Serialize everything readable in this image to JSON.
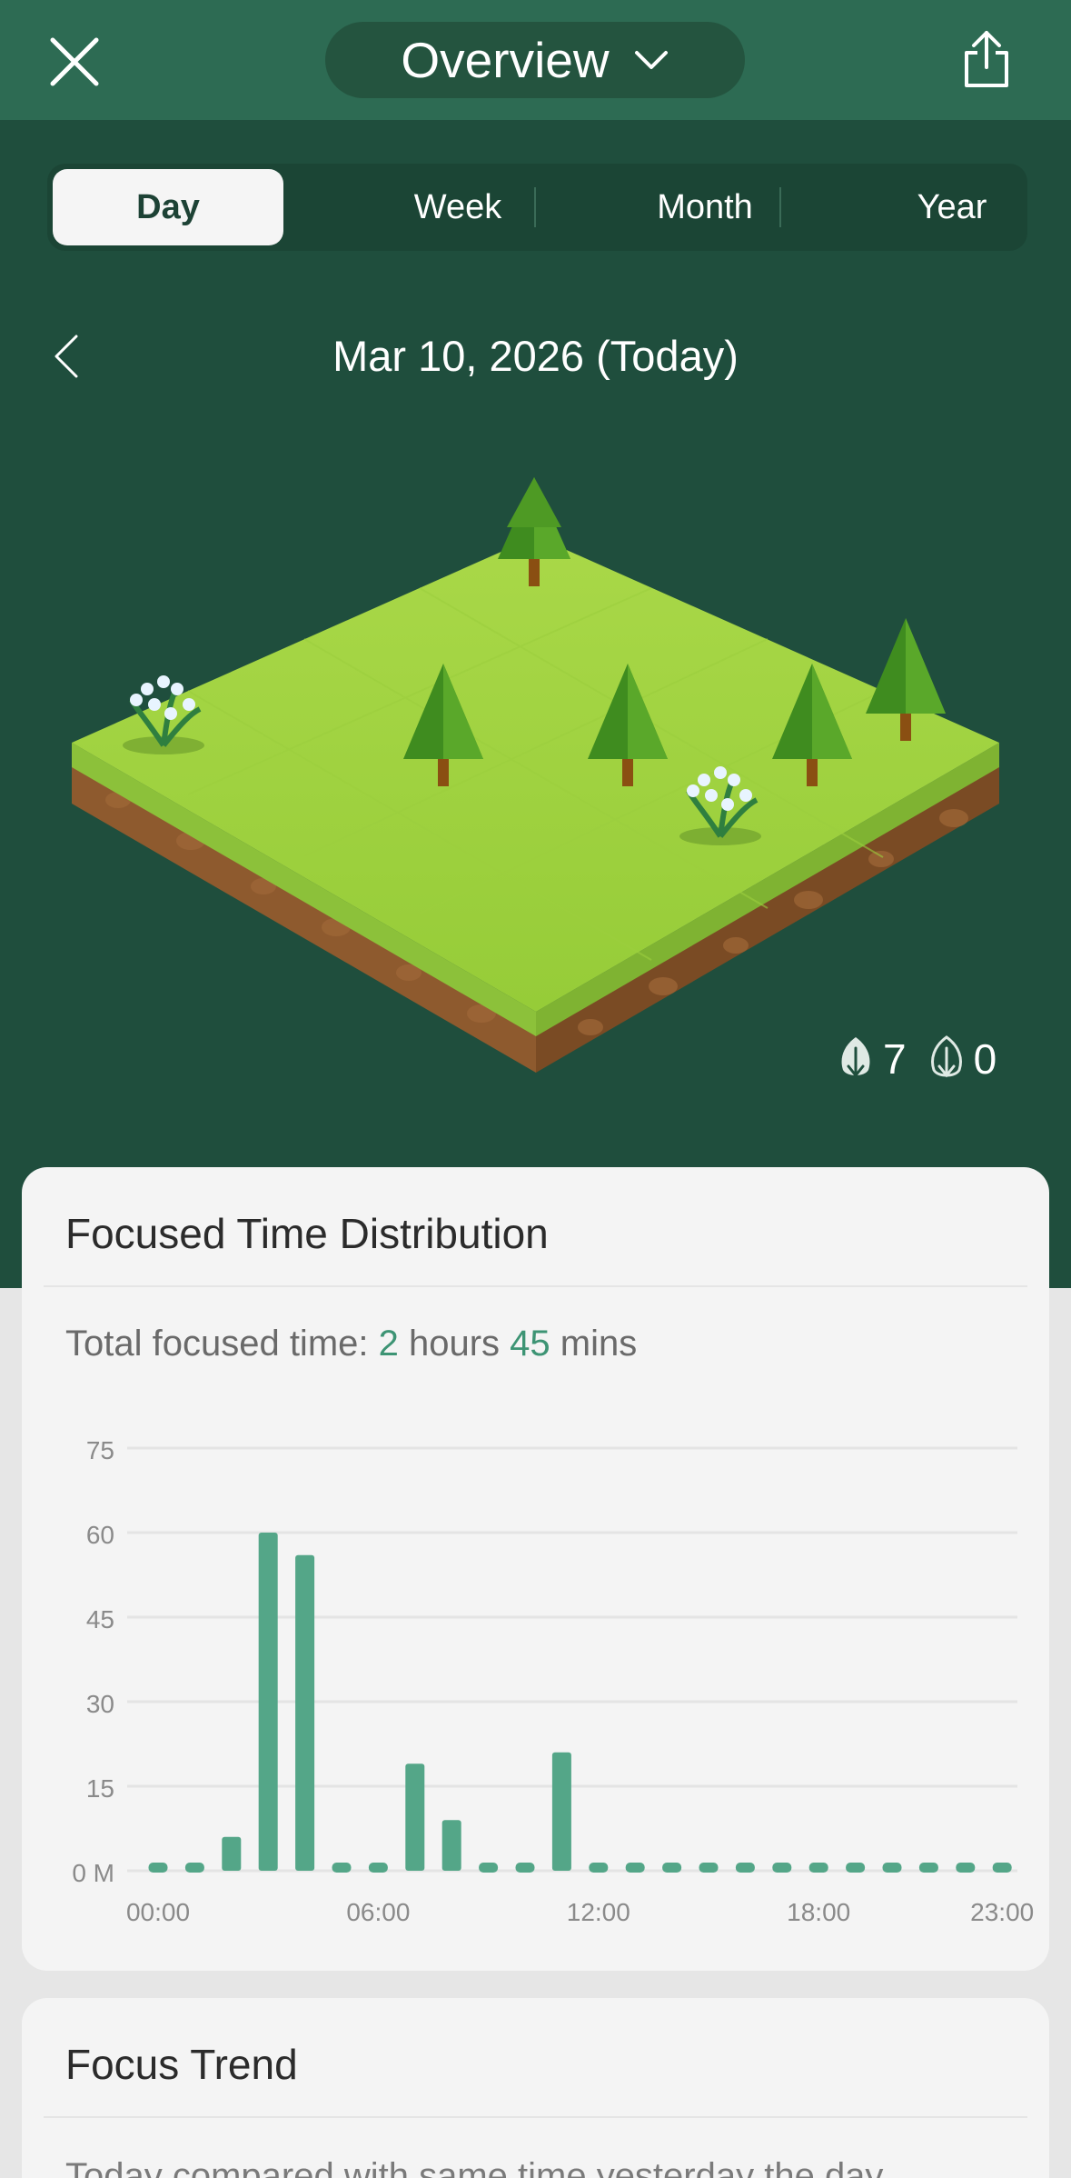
{
  "header": {
    "title": "Overview",
    "close_icon": "close-icon",
    "share_icon": "share-icon",
    "dropdown_icon": "chevron-down-icon"
  },
  "period_tabs": [
    {
      "label": "Day",
      "selected": true
    },
    {
      "label": "Week",
      "selected": false
    },
    {
      "label": "Month",
      "selected": false
    },
    {
      "label": "Year",
      "selected": false
    }
  ],
  "date_nav": {
    "date_label": "Mar 10, 2026 (Today)",
    "prev_icon": "chevron-left-icon"
  },
  "forest": {
    "healthy_trees": "7",
    "dead_trees": "0"
  },
  "focus_distribution": {
    "title": "Focused Time Distribution",
    "total_prefix": "Total focused time: ",
    "hours": "2",
    "hours_unit": " hours ",
    "mins": "45",
    "mins_unit": " mins"
  },
  "chart_data": {
    "type": "bar",
    "categories": [
      "00:00",
      "01:00",
      "02:00",
      "03:00",
      "04:00",
      "05:00",
      "06:00",
      "07:00",
      "08:00",
      "09:00",
      "10:00",
      "11:00",
      "12:00",
      "13:00",
      "14:00",
      "15:00",
      "16:00",
      "17:00",
      "18:00",
      "19:00",
      "20:00",
      "21:00",
      "22:00",
      "23:00"
    ],
    "values": [
      0,
      0,
      6,
      60,
      56,
      0,
      0,
      19,
      9,
      0,
      0,
      21,
      0,
      0,
      0,
      0,
      0,
      0,
      0,
      0,
      0,
      0,
      0,
      0
    ],
    "x_tick_labels": [
      "00:00",
      "06:00",
      "12:00",
      "18:00",
      "23:00"
    ],
    "y_tick_labels": [
      "0 M",
      "15",
      "30",
      "45",
      "60",
      "75"
    ],
    "yticks": [
      0,
      15,
      30,
      45,
      60,
      75
    ],
    "ylim": [
      0,
      75
    ],
    "grid": true,
    "bar_color": "#54a688"
  },
  "focus_trend": {
    "title": "Focus Trend",
    "subtitle": "Today compared with same time yesterday the day"
  },
  "colors": {
    "header_bg": "#2d6b53",
    "hero_bg": "#1f4e3d",
    "accent": "#3d9474",
    "card_bg": "#f4f4f4"
  }
}
